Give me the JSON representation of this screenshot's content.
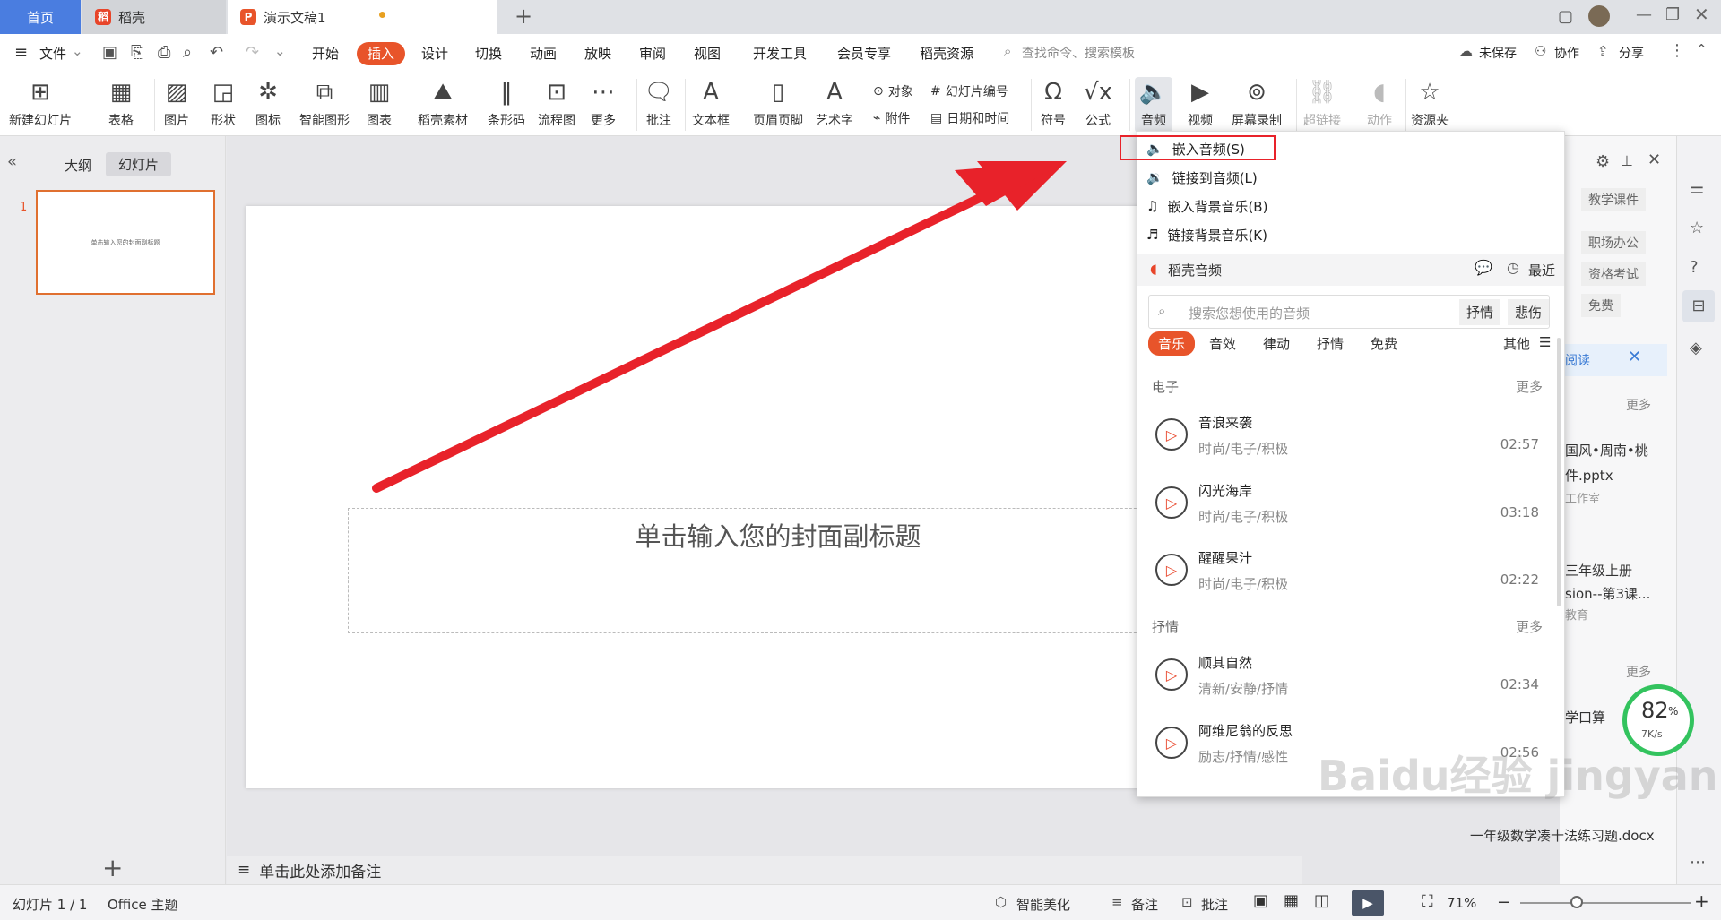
{
  "tabs": {
    "home": "首页",
    "daoke": "稻壳",
    "doc": "演示文稿1"
  },
  "menu": {
    "file": "文件",
    "items": [
      "开始",
      "插入",
      "设计",
      "切换",
      "动画",
      "放映",
      "审阅",
      "视图",
      "开发工具",
      "会员专享",
      "稻壳资源"
    ],
    "active": "插入",
    "search_placeholder": "查找命令、搜索模板",
    "unsaved": "未保存",
    "collab": "协作",
    "share": "分享"
  },
  "ribbon": {
    "new_slide": "新建幻灯片",
    "table": "表格",
    "picture": "图片",
    "shape": "形状",
    "icon": "图标",
    "smartart": "智能图形",
    "chart": "图表",
    "daoke_material": "稻壳素材",
    "barcode": "条形码",
    "flowchart": "流程图",
    "more": "更多",
    "comment": "批注",
    "textbox": "文本框",
    "header_footer": "页眉页脚",
    "wordart": "艺术字",
    "object": "对象",
    "attachment": "附件",
    "slide_number": "幻灯片编号",
    "datetime": "日期和时间",
    "symbol": "符号",
    "formula": "公式",
    "audio": "音频",
    "video": "视频",
    "screen_record": "屏幕录制",
    "hyperlink": "超链接",
    "action": "动作",
    "resource": "资源夹"
  },
  "left": {
    "outline": "大纲",
    "slides": "幻灯片",
    "slide_number": "1",
    "thumb_text": "单击输入您的封面副标题"
  },
  "slide": {
    "subtitle": "单击输入您的封面副标题"
  },
  "notes": "单击此处添加备注",
  "status": {
    "slide_count": "幻灯片 1 / 1",
    "theme": "Office 主题",
    "beautify": "智能美化",
    "notes": "备注",
    "comment": "批注",
    "zoom": "71%"
  },
  "dropdown": {
    "embed_audio": "嵌入音频(S)",
    "link_audio": "链接到音频(L)",
    "embed_bg": "嵌入背景音乐(B)",
    "link_bg": "链接背景音乐(K)",
    "section_title": "稻壳音频",
    "recent": "最近",
    "search_placeholder": "搜索您想使用的音频",
    "tag1": "抒情",
    "tag2": "悲伤",
    "cats": [
      "音乐",
      "音效",
      "律动",
      "抒情",
      "免费"
    ],
    "other": "其他",
    "group1": "电子",
    "group2": "抒情",
    "more": "更多",
    "songs": [
      {
        "name": "音浪来袭",
        "tags": "时尚/电子/积极",
        "dur": "02:57"
      },
      {
        "name": "闪光海岸",
        "tags": "时尚/电子/积极",
        "dur": "03:18"
      },
      {
        "name": "醒醒果汁",
        "tags": "时尚/电子/积极",
        "dur": "02:22"
      },
      {
        "name": "顺其自然",
        "tags": "清新/安静/抒情",
        "dur": "02:34"
      },
      {
        "name": "阿维尼翁的反思",
        "tags": "励志/抒情/感性",
        "dur": "02:56"
      }
    ]
  },
  "rightpanel": {
    "tags": [
      "教学课件",
      "职场办公",
      "资格考试",
      "免费"
    ],
    "read": "阅读",
    "more1": "更多",
    "doc1a": "国风•周南•桃",
    "doc1b": "件.pptx",
    "doc1c": "工作室",
    "doc2a": "三年级上册",
    "doc2b": "sion--第3课...",
    "doc2c": "教育",
    "more2": "更多",
    "doc3": "学口算",
    "doc4": "一年级数学凑十法练习题.docx"
  },
  "speed": {
    "percent": "82",
    "unit": "%",
    "rate": "7K/s"
  },
  "watermark": "Baidu经验 jingyan.baidu.com"
}
